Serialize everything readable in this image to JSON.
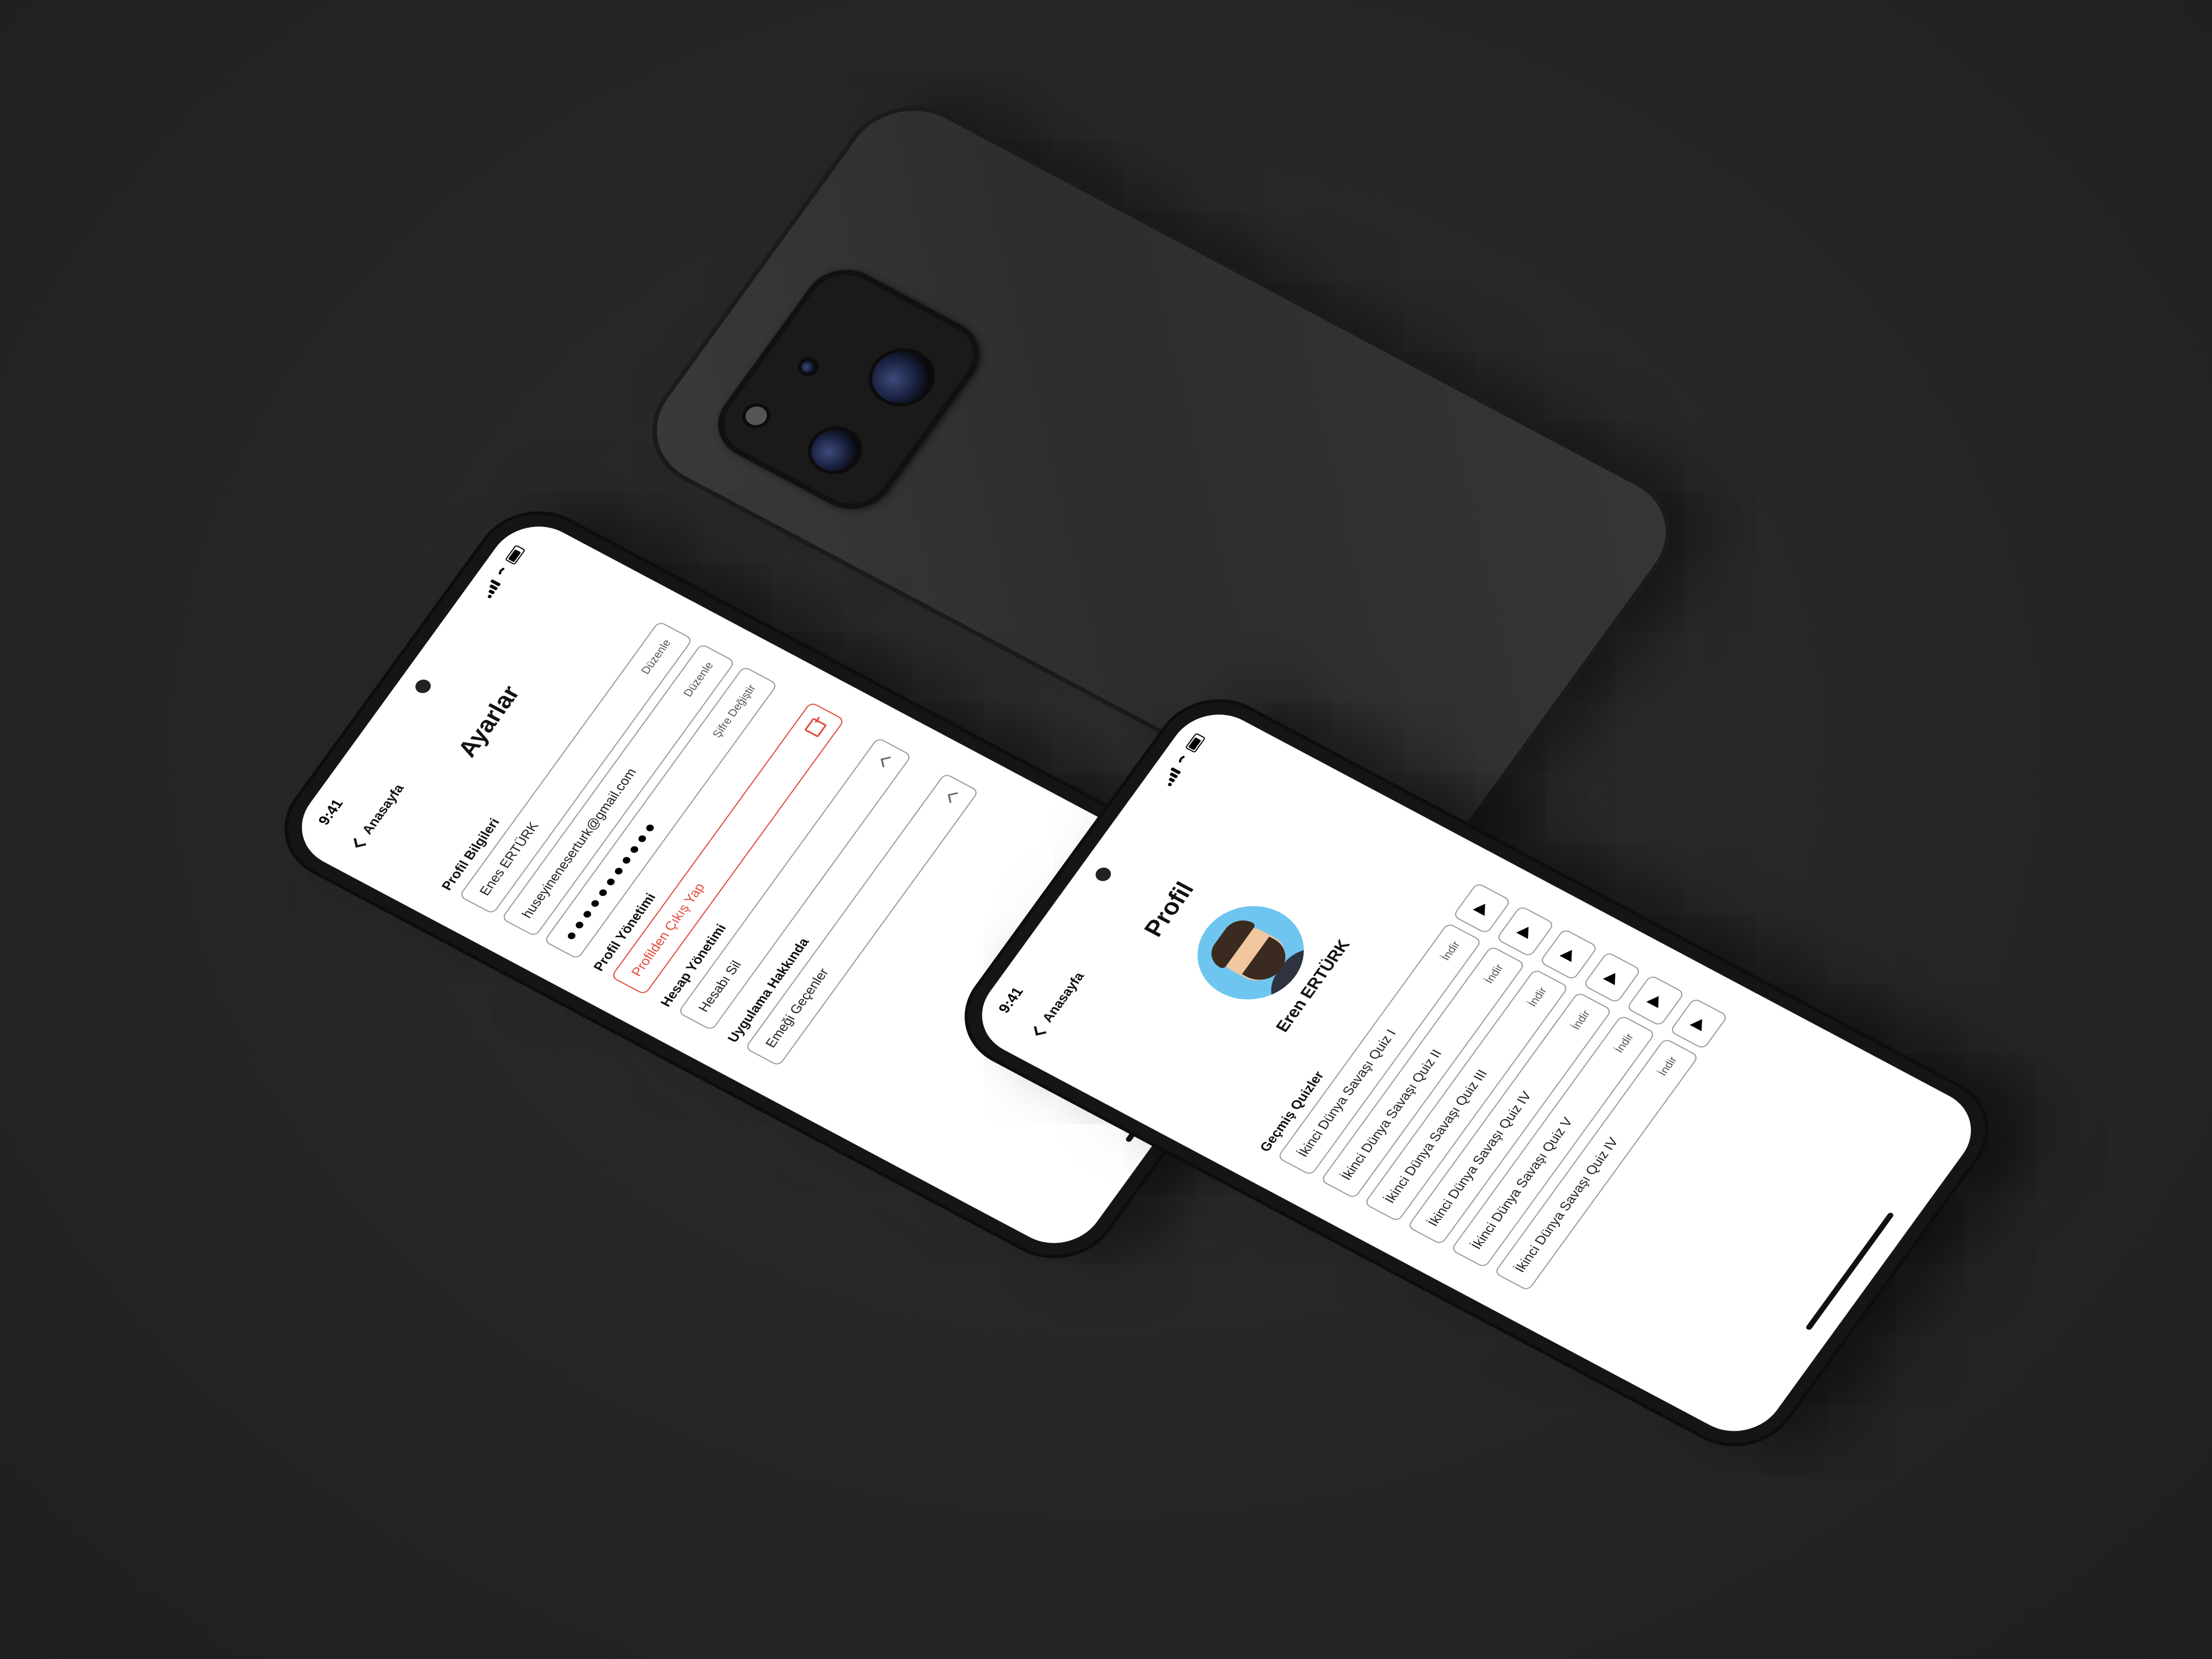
{
  "settings_screen": {
    "status_time": "9:41",
    "back_label": "Anasayfa",
    "title": "Ayarlar",
    "profile_section": "Profil Bilgileri",
    "name_value": "Enes ERTÜRK",
    "name_action": "Düzenle",
    "email_value": "huseyineneserturk@gmail.com",
    "email_action": "Düzenle",
    "password_value": "●●●●●●●●●●●",
    "password_action": "Şifre Değiştir",
    "profile_management": "Profil Yönetimi",
    "logout_label": "Profilden Çıkış Yap",
    "account_management": "Hesap Yönetimi",
    "delete_account": "Hesabı Sil",
    "about_section": "Uygulama Hakkında",
    "contributors": "Emeği Geçenler"
  },
  "profile_screen": {
    "status_time": "9:41",
    "back_label": "Anasayfa",
    "title": "Profil",
    "user_name": "Eren ERTÜRK",
    "past_quizzes_label": "Geçmiş Quizler",
    "download_label": "İndir",
    "quizzes": [
      "İkinci Dünya Savaşı Quiz I",
      "İkinci Dünya Savaşı Quiz II",
      "İkinci Dünya Savaşı Quiz III",
      "İkinci Dünya Savaşı Quiz IV",
      "İkinci Dünya Savaşı Quiz V",
      "İkinci Dünya Savaşı Quiz IV"
    ]
  }
}
